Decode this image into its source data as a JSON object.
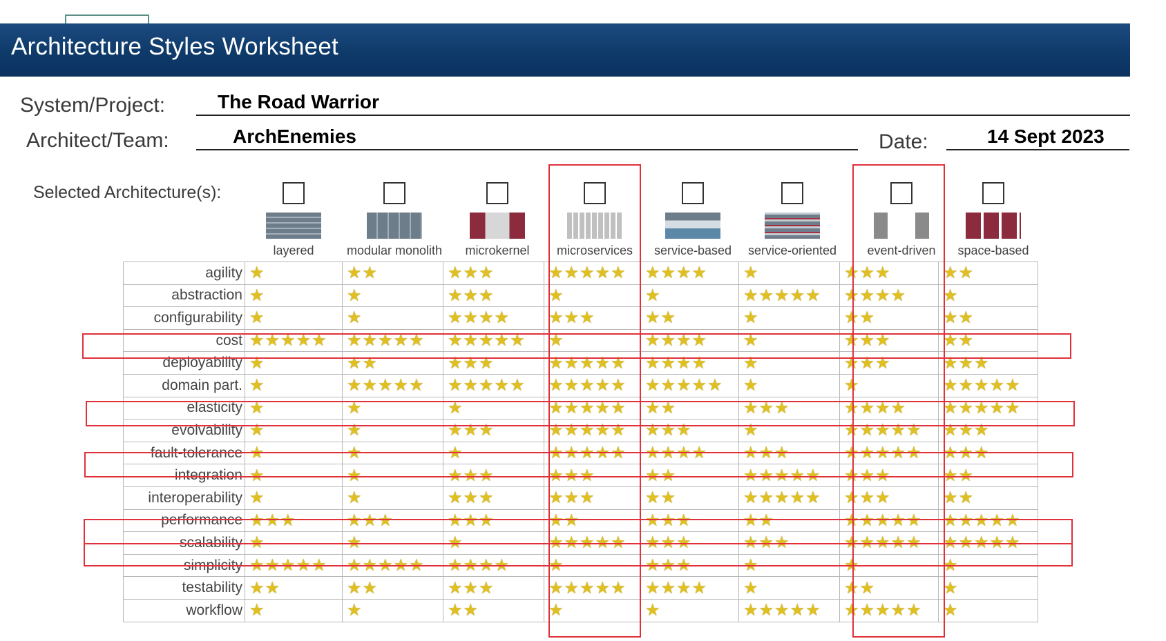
{
  "header": {
    "title": "Architecture Styles Worksheet"
  },
  "form": {
    "system_label": "System/Project:",
    "system_value": "The Road Warrior",
    "architect_label": "Architect/Team:",
    "architect_value": "ArchEnemies",
    "date_label": "Date:",
    "date_value": "14 Sept 2023"
  },
  "selected_label": "Selected Architecture(s):",
  "styles": [
    "layered",
    "modular monolith",
    "microkernel",
    "microservices",
    "service-based",
    "service-oriented",
    "event-driven",
    "space-based"
  ],
  "star_glyph": "★",
  "star_color": "#e0c020",
  "highlight_color": "#e0303a",
  "highlighted_columns": [
    "microservices",
    "event-driven"
  ],
  "highlighted_rows": [
    "cost",
    "elasticity",
    "fault-tolerance",
    "performance",
    "scalability"
  ],
  "ratings": [
    {
      "metric": "agility",
      "stars": [
        1,
        2,
        3,
        5,
        4,
        1,
        3,
        2
      ]
    },
    {
      "metric": "abstraction",
      "stars": [
        1,
        1,
        3,
        1,
        1,
        5,
        4,
        1
      ]
    },
    {
      "metric": "configurability",
      "stars": [
        1,
        1,
        4,
        3,
        2,
        1,
        2,
        2
      ]
    },
    {
      "metric": "cost",
      "stars": [
        5,
        5,
        5,
        1,
        4,
        1,
        3,
        2
      ]
    },
    {
      "metric": "deployability",
      "stars": [
        1,
        2,
        3,
        5,
        4,
        1,
        3,
        3
      ]
    },
    {
      "metric": "domain part.",
      "stars": [
        1,
        5,
        5,
        5,
        5,
        1,
        1,
        5
      ]
    },
    {
      "metric": "elasticity",
      "stars": [
        1,
        1,
        1,
        5,
        2,
        3,
        4,
        5
      ]
    },
    {
      "metric": "evolvability",
      "stars": [
        1,
        1,
        3,
        5,
        3,
        1,
        5,
        3
      ]
    },
    {
      "metric": "fault-tolerance",
      "stars": [
        1,
        1,
        1,
        5,
        4,
        3,
        5,
        3
      ]
    },
    {
      "metric": "integration",
      "stars": [
        1,
        1,
        3,
        3,
        2,
        5,
        3,
        2
      ]
    },
    {
      "metric": "interoperability",
      "stars": [
        1,
        1,
        3,
        3,
        2,
        5,
        3,
        2
      ]
    },
    {
      "metric": "performance",
      "stars": [
        3,
        3,
        3,
        2,
        3,
        2,
        5,
        5
      ]
    },
    {
      "metric": "scalability",
      "stars": [
        1,
        1,
        1,
        5,
        3,
        3,
        5,
        5
      ]
    },
    {
      "metric": "simplicity",
      "stars": [
        5,
        5,
        4,
        1,
        3,
        1,
        1,
        1
      ]
    },
    {
      "metric": "testability",
      "stars": [
        2,
        2,
        3,
        5,
        4,
        1,
        2,
        1
      ]
    },
    {
      "metric": "workflow",
      "stars": [
        1,
        1,
        2,
        1,
        1,
        5,
        5,
        1
      ]
    }
  ]
}
